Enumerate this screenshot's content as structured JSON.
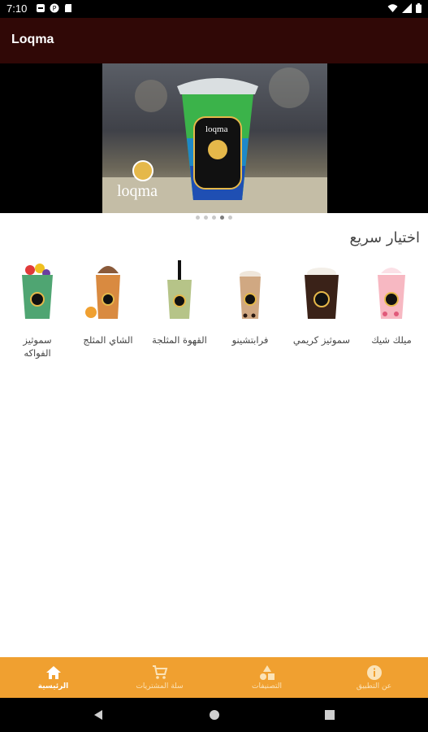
{
  "status": {
    "time": "7:10"
  },
  "app": {
    "title": "Loqma"
  },
  "banner": {
    "brand_text": "loqma",
    "cup_text": "loqma"
  },
  "carousel": {
    "count": 5,
    "active_index": 3
  },
  "quick": {
    "title": "اختيار سريع",
    "items": [
      {
        "label": "ميلك شيك"
      },
      {
        "label": "سموثيز كريمي"
      },
      {
        "label": "فرابتشينو"
      },
      {
        "label": "القهوة المثلجة"
      },
      {
        "label": "الشاي المثلج"
      },
      {
        "label": "سموثيز الفواكه"
      }
    ]
  },
  "nav": {
    "home": "الرئيسية",
    "cart": "سلة المشتريات",
    "categories": "التصنيفات",
    "about": "عن التطبيق"
  },
  "colors": {
    "appbar": "#300806",
    "bottom_nav": "#f0a030",
    "status_bar": "#000000"
  }
}
